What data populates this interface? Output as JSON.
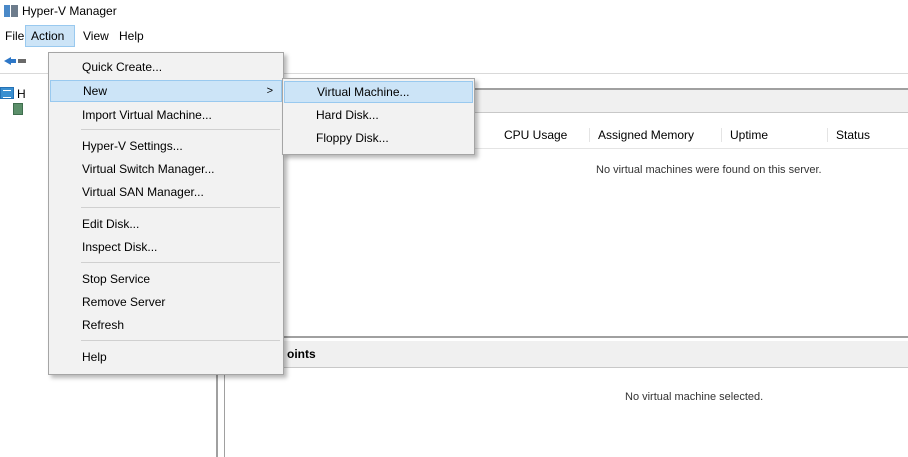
{
  "window": {
    "title": "Hyper-V Manager"
  },
  "menubar": {
    "items": [
      "File",
      "Action",
      "View",
      "Help"
    ]
  },
  "tree": {
    "root_label": "H"
  },
  "vm_list": {
    "columns": [
      "CPU Usage",
      "Assigned Memory",
      "Uptime",
      "Status"
    ],
    "empty_message": "No virtual machines were found on this server."
  },
  "checkpoints": {
    "header_fragment": "oints",
    "empty_message": "No virtual machine selected."
  },
  "action_menu": {
    "items": [
      "Quick Create...",
      "New",
      "Import Virtual Machine...",
      "Hyper-V Settings...",
      "Virtual Switch Manager...",
      "Virtual SAN Manager...",
      "Edit Disk...",
      "Inspect Disk...",
      "Stop Service",
      "Remove Server",
      "Refresh",
      "Help"
    ],
    "submenu_arrow": ">"
  },
  "new_submenu": {
    "items": [
      "Virtual Machine...",
      "Hard Disk...",
      "Floppy Disk..."
    ]
  }
}
